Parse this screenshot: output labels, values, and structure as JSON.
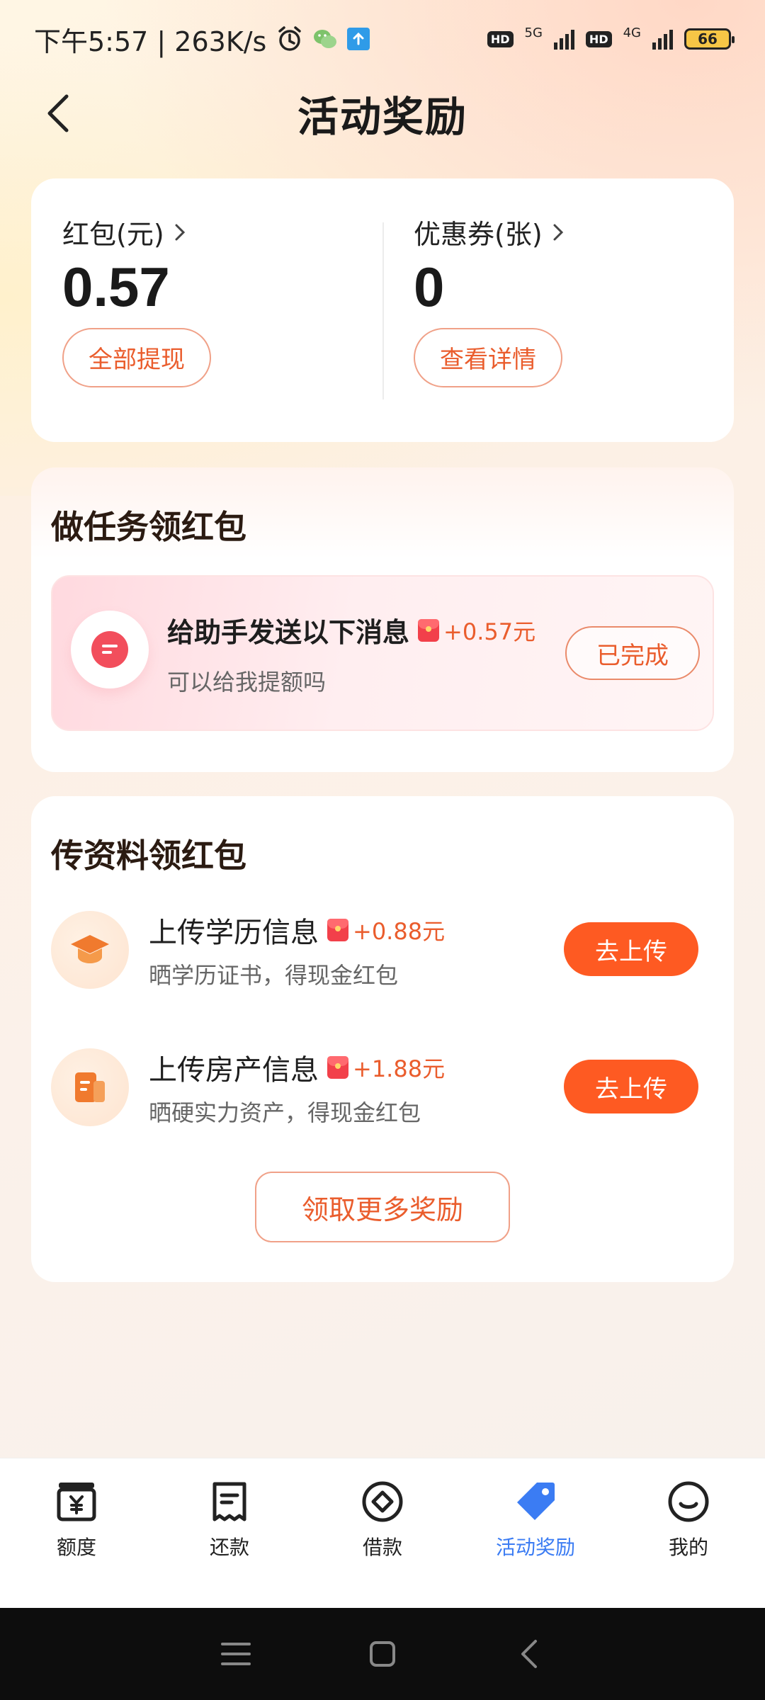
{
  "status_bar": {
    "time_speed": "下午5:57 | 263K/s",
    "network_1": "5G",
    "network_2": "4G",
    "hd": "HD",
    "battery": "66"
  },
  "header": {
    "title": "活动奖励"
  },
  "wallet": {
    "red_packet_label": "红包(元)",
    "red_packet_value": "0.57",
    "red_packet_button": "全部提现",
    "coupon_label": "优惠券(张)",
    "coupon_value": "0",
    "coupon_button": "查看详情"
  },
  "task_section": {
    "title": "做任务领红包",
    "items": [
      {
        "title": "给助手发送以下消息",
        "reward": "+0.57元",
        "subtitle": "可以给我提额吗",
        "button": "已完成"
      }
    ]
  },
  "upload_section": {
    "title": "传资料领红包",
    "items": [
      {
        "title": "上传学历信息",
        "reward": "+0.88元",
        "subtitle": "晒学历证书，得现金红包",
        "button": "去上传",
        "icon": "graduation-cap-icon"
      },
      {
        "title": "上传房产信息",
        "reward": "+1.88元",
        "subtitle": "晒硬实力资产，得现金红包",
        "button": "去上传",
        "icon": "property-document-icon"
      }
    ],
    "more_button": "领取更多奖励"
  },
  "bottom_nav": {
    "items": [
      {
        "label": "额度",
        "icon": "quota-icon"
      },
      {
        "label": "还款",
        "icon": "repay-icon"
      },
      {
        "label": "借款",
        "icon": "borrow-icon"
      },
      {
        "label": "活动奖励",
        "icon": "tag-icon",
        "active": true
      },
      {
        "label": "我的",
        "icon": "smile-icon"
      }
    ]
  },
  "colors": {
    "accent": "#fe5a22",
    "accent_text": "#ea5d2d",
    "nav_active": "#3b7cf3"
  }
}
